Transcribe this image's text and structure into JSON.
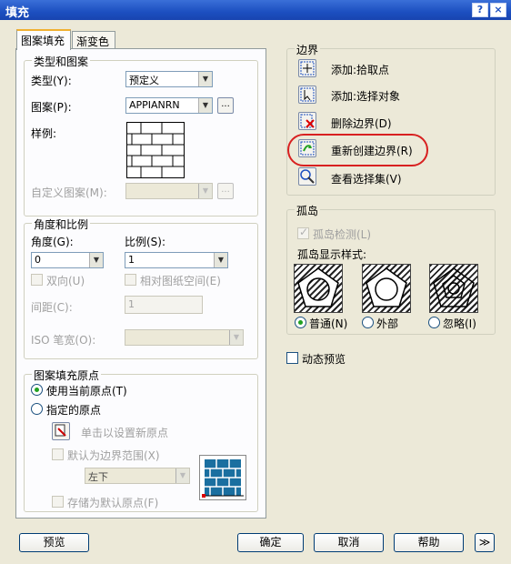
{
  "window": {
    "title": "填充",
    "help_btn": "?",
    "close_btn": "×"
  },
  "tabs": [
    {
      "label": "图案填充"
    },
    {
      "label": "渐变色"
    }
  ],
  "type_pattern": {
    "title": "类型和图案",
    "type_label": "类型(Y):",
    "type_value": "预定义",
    "pattern_label": "图案(P):",
    "pattern_value": "APPIANRN",
    "browse": "...",
    "sample_label": "样例:",
    "custom_label": "自定义图案(M):",
    "custom_browse": "..."
  },
  "angle_scale": {
    "title": "角度和比例",
    "angle_label": "角度(G):",
    "angle_value": "0",
    "scale_label": "比例(S):",
    "scale_value": "1",
    "double_label": "双向(U)",
    "relative_label": "相对图纸空间(E)",
    "spacing_label": "间距(C):",
    "spacing_value": "1",
    "iso_label": "ISO 笔宽(O):"
  },
  "origin": {
    "title": "图案填充原点",
    "use_current": "使用当前原点(T)",
    "specified": "指定的原点",
    "click_set": "单击以设置新原点",
    "default_extents": "默认为边界范围(X)",
    "position_value": "左下",
    "store_default": "存储为默认原点(F)"
  },
  "boundaries": {
    "title": "边界",
    "add_pick": "添加:拾取点",
    "add_select": "添加:选择对象",
    "remove": "删除边界(D)",
    "recreate": "重新创建边界(R)",
    "view_selection": "查看选择集(V)"
  },
  "islands": {
    "title": "孤岛",
    "detect": "孤岛检测(L)",
    "style_label": "孤岛显示样式:",
    "normal": "普通(N)",
    "outer": "外部",
    "ignore": "忽略(I)"
  },
  "dynamic_preview": "动态预览",
  "footer": {
    "preview": "预览",
    "ok": "确定",
    "cancel": "取消",
    "help": "帮助",
    "more": "≫"
  },
  "colors": {
    "titlebar": "#1c4fc0",
    "highlight_oval": "#d82020",
    "dialog_bg": "#ece9d8"
  }
}
